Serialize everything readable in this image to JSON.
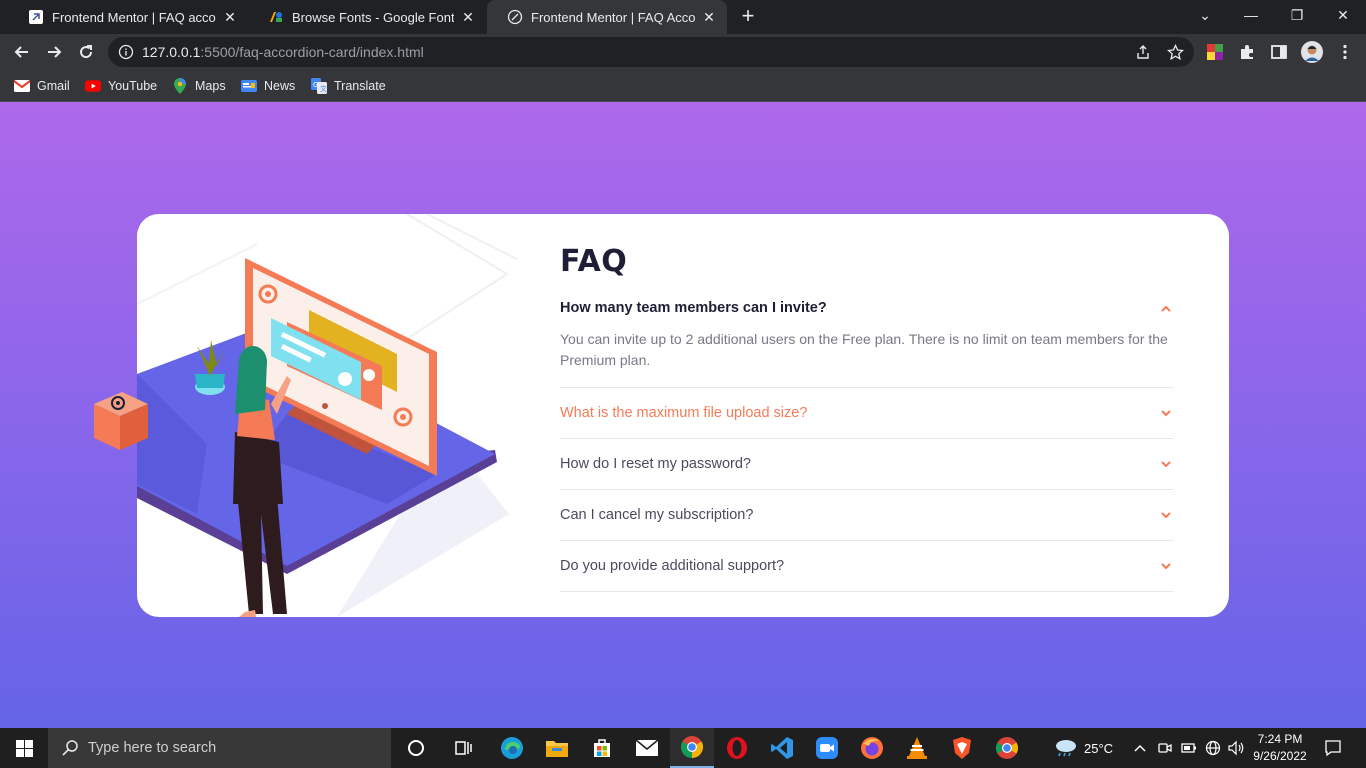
{
  "browser": {
    "tabs": [
      {
        "title": "Frontend Mentor | FAQ accordion",
        "close": "✕",
        "active": false
      },
      {
        "title": "Browse Fonts - Google Fonts",
        "close": "✕",
        "active": false
      },
      {
        "title": "Frontend Mentor | FAQ Accordion",
        "close": "✕",
        "active": true
      }
    ],
    "new_tab": "+",
    "window_controls": {
      "tab_search": "⌄",
      "minimize": "—",
      "restore": "❐",
      "close": "✕"
    },
    "url_host": "127.0.0.1",
    "url_rest": ":5500/faq-accordion-card/index.html",
    "bookmarks": [
      {
        "label": "Gmail",
        "icon": "gmail-icon"
      },
      {
        "label": "YouTube",
        "icon": "youtube-icon"
      },
      {
        "label": "Maps",
        "icon": "maps-icon"
      },
      {
        "label": "News",
        "icon": "news-icon"
      },
      {
        "label": "Translate",
        "icon": "translate-icon"
      }
    ]
  },
  "page": {
    "background_top": "#ae68ea",
    "background_bottom": "#6564e7",
    "heading": "FAQ",
    "accent": "#f47b56",
    "items": [
      {
        "question": "How many team members can I invite?",
        "answer": "You can invite up to 2 additional users on the Free plan. There is no limit on team members for the Premium plan.",
        "expanded": true
      },
      {
        "question": "What is the maximum file upload size?",
        "expanded": false,
        "hovered": true
      },
      {
        "question": "How do I reset my password?",
        "expanded": false
      },
      {
        "question": "Can I cancel my subscription?",
        "expanded": false
      },
      {
        "question": "Do you provide additional support?",
        "expanded": false
      }
    ]
  },
  "taskbar": {
    "search_placeholder": "Type here to search",
    "apps": [
      "cortana-icon",
      "task-view-icon",
      "edge-icon",
      "file-explorer-icon",
      "store-icon",
      "mail-icon",
      "chrome-icon",
      "opera-icon",
      "vscode-icon",
      "zoom-icon",
      "firefox-icon",
      "vlc-icon",
      "brave-icon",
      "chrome-icon"
    ],
    "weather": "25°C",
    "time": "7:24 PM",
    "date": "9/26/2022"
  }
}
